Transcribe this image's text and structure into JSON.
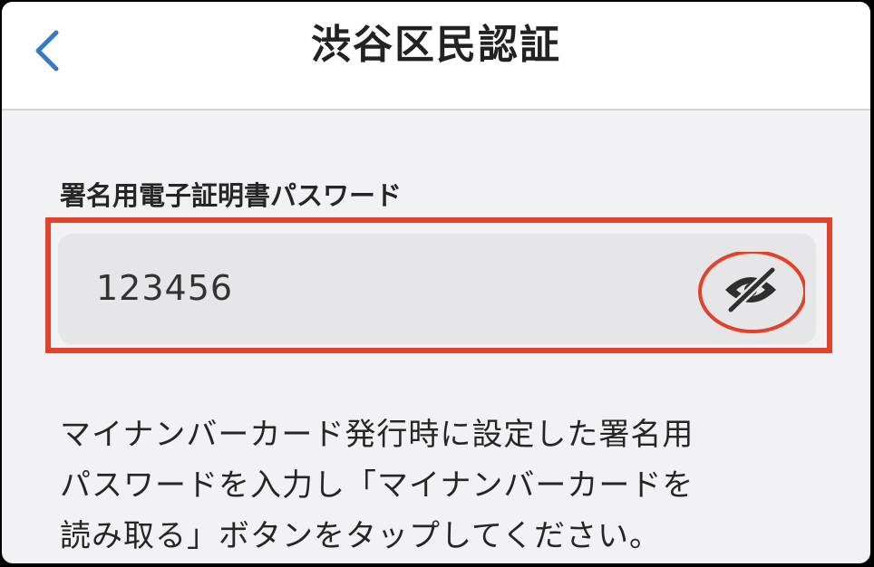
{
  "header": {
    "title": "渋谷区民認証",
    "back_icon": "chevron-left-icon",
    "accent_color": "#3478c8"
  },
  "form": {
    "password_label": "署名用電子証明書パスワード",
    "password_value": "123456",
    "visibility_icon": "eye-slash-icon",
    "highlight_color": "#e2412a"
  },
  "description": "マイナンバーカード発行時に設定した署名用\nパスワードを入力し「マイナンバーカードを\n読み取る」ボタンをタップしてください。"
}
